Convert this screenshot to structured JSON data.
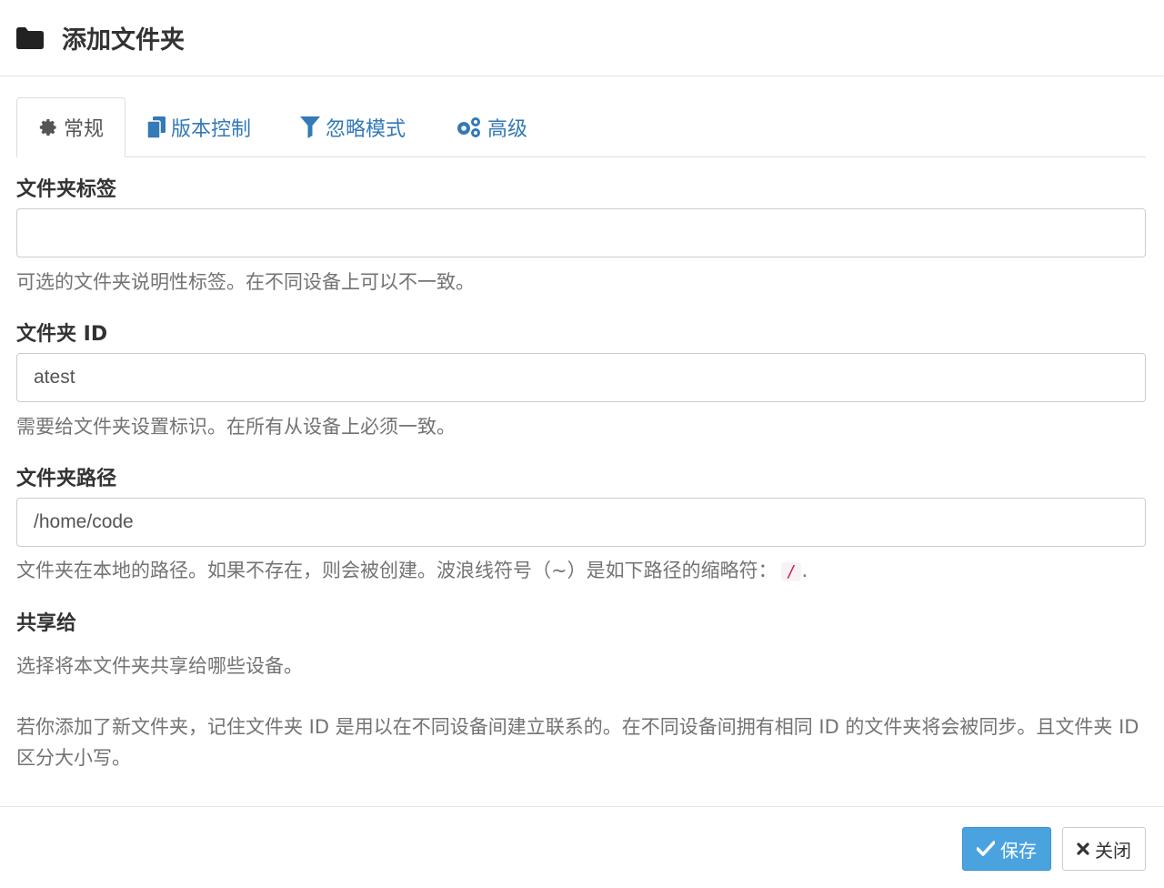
{
  "dialog": {
    "title": "添加文件夹",
    "icon": "folder-icon"
  },
  "tabs": [
    {
      "label": "常规",
      "icon": "gear-icon",
      "active": true
    },
    {
      "label": "版本控制",
      "icon": "files-icon",
      "active": false
    },
    {
      "label": "忽略模式",
      "icon": "filter-icon",
      "active": false
    },
    {
      "label": "高级",
      "icon": "gears-icon",
      "active": false
    }
  ],
  "fields": {
    "label": {
      "title": "文件夹标签",
      "value": "",
      "help": "可选的文件夹说明性标签。在不同设备上可以不一致。"
    },
    "id": {
      "title": "文件夹 ID",
      "value": "atest",
      "help": "需要给文件夹设置标识。在所有从设备上必须一致。"
    },
    "path": {
      "title": "文件夹路径",
      "value": "/home/code",
      "help": "文件夹在本地的路径。如果不存在，则会被创建。波浪线符号（~）是如下路径的缩略符：",
      "help_code": "/",
      "help_suffix": "."
    },
    "share": {
      "title": "共享给",
      "help": "选择将本文件夹共享给哪些设备。"
    }
  },
  "note": "若你添加了新文件夹，记住文件夹 ID 是用以在不同设备间建立联系的。在不同设备间拥有相同 ID 的文件夹将会被同步。且文件夹 ID 区分大小写。",
  "footer": {
    "save_label": "保存",
    "close_label": "关闭"
  },
  "colors": {
    "link": "#337ab7",
    "primary": "#4aa3df",
    "code": "#c7254e"
  }
}
